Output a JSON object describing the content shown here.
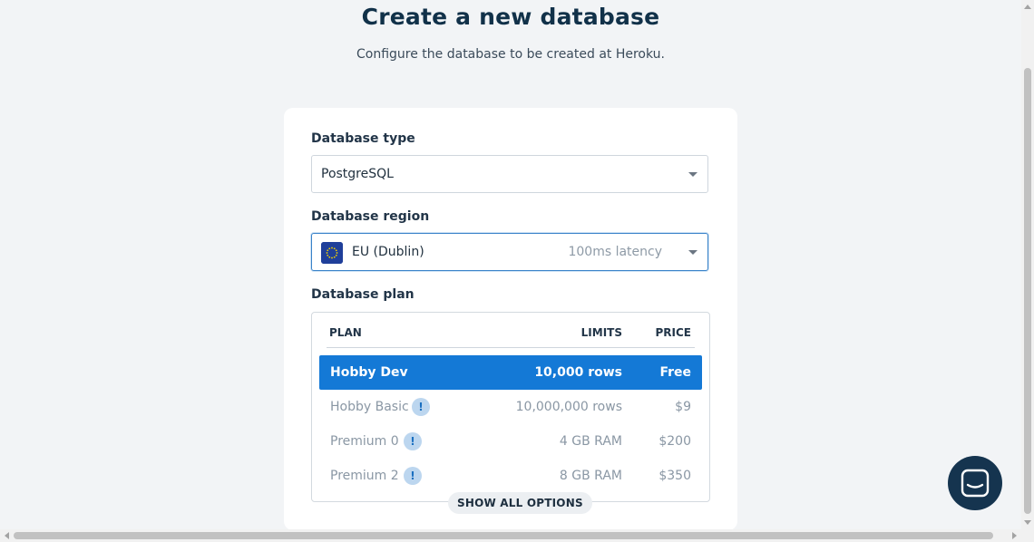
{
  "page": {
    "title": "Create a new database",
    "subtitle": "Configure the database to be created at Heroku."
  },
  "form": {
    "db_type": {
      "label": "Database type",
      "value": "PostgreSQL"
    },
    "db_region": {
      "label": "Database region",
      "value": "EU (Dublin)",
      "latency": "100ms latency",
      "flag_icon": "eu-flag-icon"
    },
    "db_plan": {
      "label": "Database plan",
      "columns": {
        "plan": "PLAN",
        "limits": "LIMITS",
        "price": "PRICE"
      },
      "rows": [
        {
          "name": "Hobby Dev",
          "limit": "10,000 rows",
          "price": "Free",
          "selected": true,
          "info": false
        },
        {
          "name": "Hobby Basic",
          "limit": "10,000,000 rows",
          "price": "$9",
          "selected": false,
          "info": true
        },
        {
          "name": "Premium 0",
          "limit": "4 GB RAM",
          "price": "$200",
          "selected": false,
          "info": true
        },
        {
          "name": "Premium 2",
          "limit": "8 GB RAM",
          "price": "$350",
          "selected": false,
          "info": true
        }
      ],
      "info_glyph": "!",
      "show_all": "SHOW ALL OPTIONS"
    }
  },
  "colors": {
    "accent": "#1479d6",
    "heading": "#113149",
    "chat_button": "#15344f",
    "background": "#f2f4f6"
  },
  "icons": [
    "caret-down-icon",
    "eu-flag-icon",
    "info-icon",
    "chat-icon"
  ]
}
